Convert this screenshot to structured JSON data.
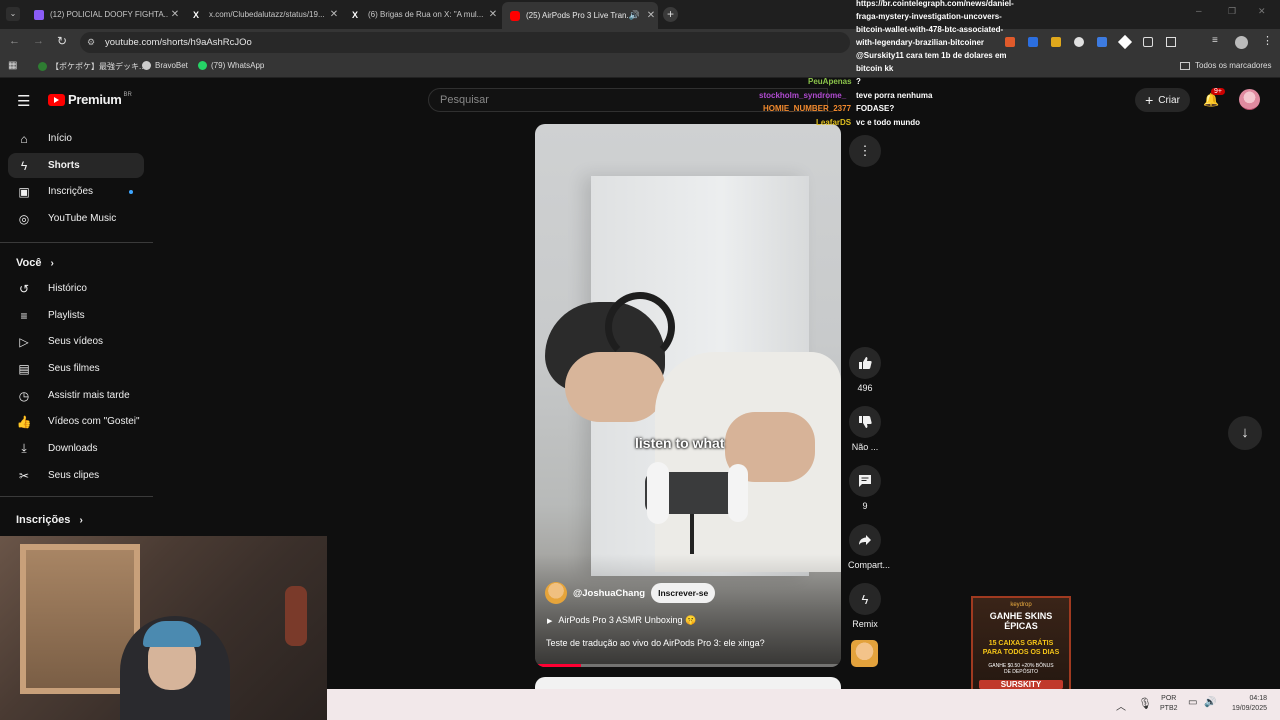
{
  "browser": {
    "tabs": [
      {
        "title": "(12) POLICIAL DOOFY FIGHTA...",
        "favicon_color": "#8b5cf6",
        "active": false
      },
      {
        "title": "x.com/Clubedalutazz/status/19...",
        "favicon_color": "#ffffff",
        "active": false
      },
      {
        "title": "(6) Brigas de Rua on X: \"A mul...",
        "favicon_color": "#ffffff",
        "active": false
      },
      {
        "title": "(25) AirPods Pro 3 Live Tran...",
        "favicon_color": "#ff0000",
        "active": true
      }
    ],
    "url": "youtube.com/shorts/h9aAshRcJOo",
    "bookmarks": [
      {
        "label": "【ポケポケ】最強デッキ...",
        "color": "#2e7d32"
      },
      {
        "label": "BravoBet",
        "color": "#ffffff"
      },
      {
        "label": "(79) WhatsApp",
        "color": "#25d366"
      }
    ],
    "all_bookmarks": "Todos os marcadores"
  },
  "chat": {
    "lines": [
      {
        "user": "",
        "text": "https://br.cointelegraph.com/news/daniel-"
      },
      {
        "user": "",
        "text": "fraga-mystery-investigation-uncovers-"
      },
      {
        "user": "",
        "text": "bitcoin-wallet-with-478-btc-associated-"
      },
      {
        "user": "",
        "text": "with-legendary-brazilian-bitcoiner"
      },
      {
        "user": "",
        "text": "@Surskity11 cara tem 1b de dolares em"
      },
      {
        "user": "",
        "text": "bitcoin kk"
      },
      {
        "user": "PeuApenas",
        "text": "?"
      },
      {
        "user": "stockholm_syndrome_",
        "text": "teve porra nenhuma"
      },
      {
        "user": "HOMIE_NUMBER_2377",
        "text": "FODASE?"
      },
      {
        "user": "LeafarDS",
        "text": "vc e todo mundo"
      }
    ]
  },
  "youtube": {
    "logo": "Premium",
    "region": "BR",
    "search_placeholder": "Pesquisar",
    "create_label": "Criar",
    "notif_badge": "9+",
    "sidebar": {
      "main": [
        "Início",
        "Shorts",
        "Inscrições",
        "YouTube Music"
      ],
      "you_heading": "Você",
      "you": [
        "Histórico",
        "Playlists",
        "Seus vídeos",
        "Seus filmes",
        "Assistir mais tarde",
        "Vídeos com \"Gostei\"",
        "Downloads",
        "Seus clipes"
      ],
      "subs_heading": "Inscrições"
    },
    "short": {
      "caption": "listen to what",
      "channel": "@JoshuaChang",
      "subscribe": "Inscrever-se",
      "playlist": "AirPods Pro 3 ASMR Unboxing 🤫",
      "title": "Teste de tradução ao vivo do AirPods Pro 3: ele xinga?"
    },
    "actions": {
      "likes": "496",
      "dislike": "Não ...",
      "comments": "9",
      "share": "Compart...",
      "remix": "Remix"
    }
  },
  "ad": {
    "brand": "keydrop",
    "headline": "GANHE SKINS ÉPICAS",
    "offer": "15 CAIXAS GRÁTIS PARA TODOS OS DIAS",
    "bonus": "GANHE $0.50 +20% BÔNUS DE DEPÓSITO",
    "code": "SURSKITY"
  },
  "taskbar": {
    "lang": "POR",
    "layout": "PTB2",
    "time": "04:18",
    "date": "19/09/2025"
  }
}
